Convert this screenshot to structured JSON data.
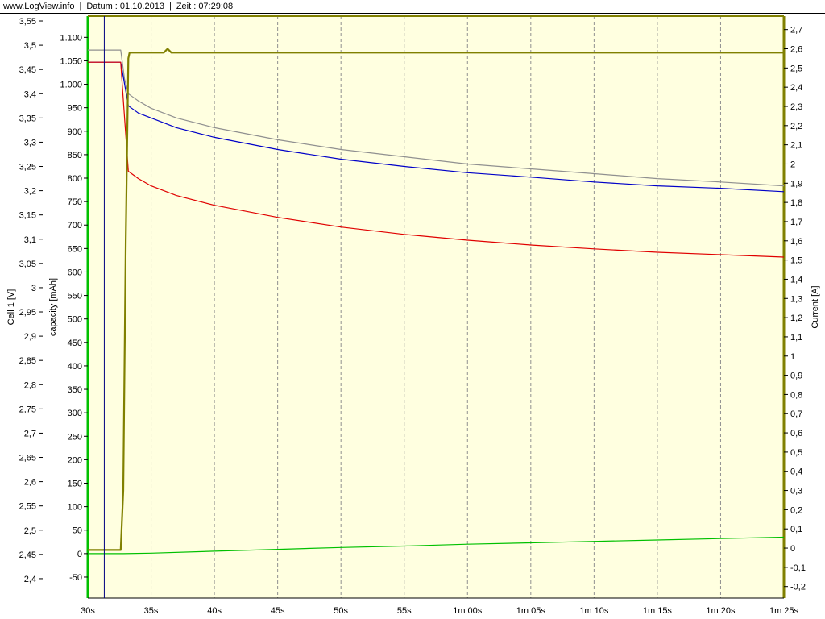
{
  "header": {
    "site": "www.LogView.info",
    "date": "Datum : 01.10.2013",
    "time": "Zeit : 07:29:08"
  },
  "colors": {
    "plot_background": "#FFFFE0",
    "cell_voltage": "#E00000",
    "capacity": "#00C000",
    "current": "#808000",
    "blue_series": "#0000C8",
    "gray_series": "#909090",
    "cursor": "#000080"
  },
  "chart_data": {
    "type": "line",
    "title": "",
    "grid": true,
    "x_axis": {
      "label": "",
      "range_s": [
        30,
        85
      ],
      "tick_values_s": [
        30,
        35,
        40,
        45,
        50,
        55,
        60,
        65,
        70,
        75,
        80,
        85
      ],
      "tick_labels": [
        "30s",
        "35s",
        "40s",
        "45s",
        "50s",
        "55s",
        "1m 00s",
        "1m 05s",
        "1m 10s",
        "1m 15s",
        "1m 20s",
        "1m 25s"
      ]
    },
    "cursor_x_s": 31.3,
    "y_axes": [
      {
        "id": "voltage",
        "label": "Cell 1 [V]",
        "side": "left",
        "range": [
          2.36,
          3.56
        ],
        "ticks": [
          2.4,
          2.45,
          2.5,
          2.55,
          2.6,
          2.65,
          2.7,
          2.75,
          2.8,
          2.85,
          2.9,
          2.95,
          3.0,
          3.05,
          3.1,
          3.15,
          3.2,
          3.25,
          3.3,
          3.35,
          3.4,
          3.45,
          3.5,
          3.55
        ],
        "tick_labels": [
          "2,4",
          "2,45",
          "2,5",
          "2,55",
          "2,6",
          "2,65",
          "2,7",
          "2,75",
          "2,8",
          "2,85",
          "2,9",
          "2,95",
          "3",
          "3,05",
          "3,1",
          "3,15",
          "3,2",
          "3,25",
          "3,3",
          "3,35",
          "3,4",
          "3,45",
          "3,5",
          "3,55"
        ]
      },
      {
        "id": "capacity",
        "label": "capacity [mAh]",
        "side": "left",
        "range": [
          -94.7,
          1145.2
        ],
        "ticks": [
          -50,
          0,
          50,
          100,
          150,
          200,
          250,
          300,
          350,
          400,
          450,
          500,
          550,
          600,
          650,
          700,
          750,
          800,
          850,
          900,
          950,
          1000,
          1050,
          1100
        ],
        "tick_labels": [
          "-50",
          "0",
          "50",
          "100",
          "150",
          "200",
          "250",
          "300",
          "350",
          "400",
          "450",
          "500",
          "550",
          "600",
          "650",
          "700",
          "750",
          "800",
          "850",
          "900",
          "950",
          "1.000",
          "1.050",
          "1.100"
        ]
      },
      {
        "id": "current",
        "label": "Current [A]",
        "side": "right",
        "range": [
          -0.26,
          2.77
        ],
        "ticks": [
          -0.2,
          -0.1,
          0,
          0.1,
          0.2,
          0.3,
          0.4,
          0.5,
          0.6,
          0.7,
          0.8,
          0.9,
          1.0,
          1.1,
          1.2,
          1.3,
          1.4,
          1.5,
          1.6,
          1.7,
          1.8,
          1.9,
          2.0,
          2.1,
          2.2,
          2.3,
          2.4,
          2.5,
          2.6,
          2.7
        ],
        "tick_labels": [
          "-0,2",
          "-0,1",
          "0",
          "0,1",
          "0,2",
          "0,3",
          "0,4",
          "0,5",
          "0,6",
          "0,7",
          "0,8",
          "0,9",
          "1",
          "1,1",
          "1,2",
          "1,3",
          "1,4",
          "1,5",
          "1,6",
          "1,7",
          "1,8",
          "1,9",
          "2",
          "2,1",
          "2,2",
          "2,3",
          "2,4",
          "2,5",
          "2,6",
          "2,7"
        ]
      }
    ],
    "series": [
      {
        "id": "gray",
        "axis": "voltage",
        "x": [
          30,
          32.6,
          32.9,
          33.2,
          34,
          35,
          37,
          40,
          45,
          50,
          55,
          60,
          65,
          70,
          75,
          80,
          85
        ],
        "y": [
          3.49,
          3.49,
          3.43,
          3.4,
          3.385,
          3.37,
          3.35,
          3.33,
          3.305,
          3.285,
          3.27,
          3.255,
          3.245,
          3.235,
          3.225,
          3.218,
          3.21
        ]
      },
      {
        "id": "blue",
        "axis": "voltage",
        "x": [
          30,
          32.6,
          32.9,
          33.2,
          34,
          35,
          37,
          40,
          45,
          50,
          55,
          60,
          65,
          70,
          75,
          80,
          85
        ],
        "y": [
          3.465,
          3.465,
          3.42,
          3.375,
          3.36,
          3.35,
          3.33,
          3.31,
          3.285,
          3.265,
          3.25,
          3.237,
          3.228,
          3.218,
          3.21,
          3.205,
          3.198
        ]
      },
      {
        "id": "cell1_voltage",
        "axis": "voltage",
        "x": [
          30,
          32.6,
          32.9,
          33.2,
          34,
          35,
          37,
          40,
          45,
          50,
          55,
          60,
          65,
          70,
          75,
          80,
          85
        ],
        "y": [
          3.465,
          3.465,
          3.35,
          3.24,
          3.225,
          3.21,
          3.19,
          3.17,
          3.145,
          3.125,
          3.11,
          3.098,
          3.088,
          3.08,
          3.073,
          3.068,
          3.063
        ]
      },
      {
        "id": "capacity",
        "axis": "capacity",
        "x": [
          30,
          32.8,
          35,
          40,
          45,
          50,
          55,
          60,
          65,
          70,
          75,
          80,
          85
        ],
        "y": [
          0,
          0,
          1,
          5,
          9,
          13,
          16,
          20,
          23,
          26,
          29,
          32,
          35
        ]
      },
      {
        "id": "current",
        "axis": "current",
        "x": [
          30,
          31,
          32.6,
          32.8,
          33.0,
          33.2,
          33.3,
          36,
          36.3,
          36.6,
          42,
          42.3,
          84,
          85
        ],
        "y": [
          -0.01,
          -0.01,
          -0.01,
          0.3,
          1.6,
          2.55,
          2.58,
          2.58,
          2.6,
          2.58,
          2.58,
          2.58,
          2.58,
          2.58
        ]
      }
    ]
  }
}
